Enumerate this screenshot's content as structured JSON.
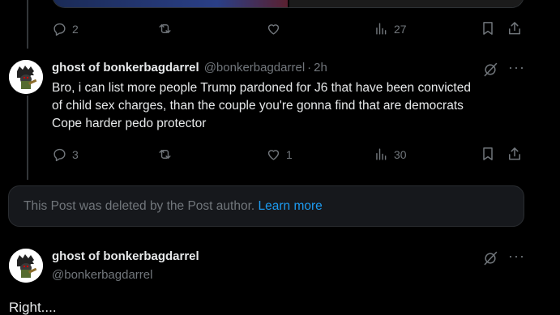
{
  "prev_post": {
    "actions": {
      "replies": "2",
      "retweets": "",
      "likes": "",
      "views": "27"
    }
  },
  "reply_post": {
    "author_name": "ghost of bonkerbagdarrel",
    "handle": "@bonkerbagdarrel",
    "separator": "·",
    "time": "2h",
    "text_lines": [
      "Bro, i can list more people Trump pardoned for J6 that have been convicted",
      "of child sex charges, than the couple you're gonna find that are democrats",
      "Cope harder pedo protector"
    ],
    "actions": {
      "replies": "3",
      "retweets": "",
      "likes": "1",
      "views": "30"
    }
  },
  "deleted_notice": {
    "text": "This Post was deleted by the Post author.",
    "link": "Learn more"
  },
  "focused_post": {
    "author_name": "ghost of bonkerbagdarrel",
    "handle": "@bonkerbagdarrel",
    "text": "Right...."
  },
  "colors": {
    "background": "#000000",
    "muted": "#71767b",
    "link": "#1d9bf0",
    "text": "#e7e9ea"
  }
}
